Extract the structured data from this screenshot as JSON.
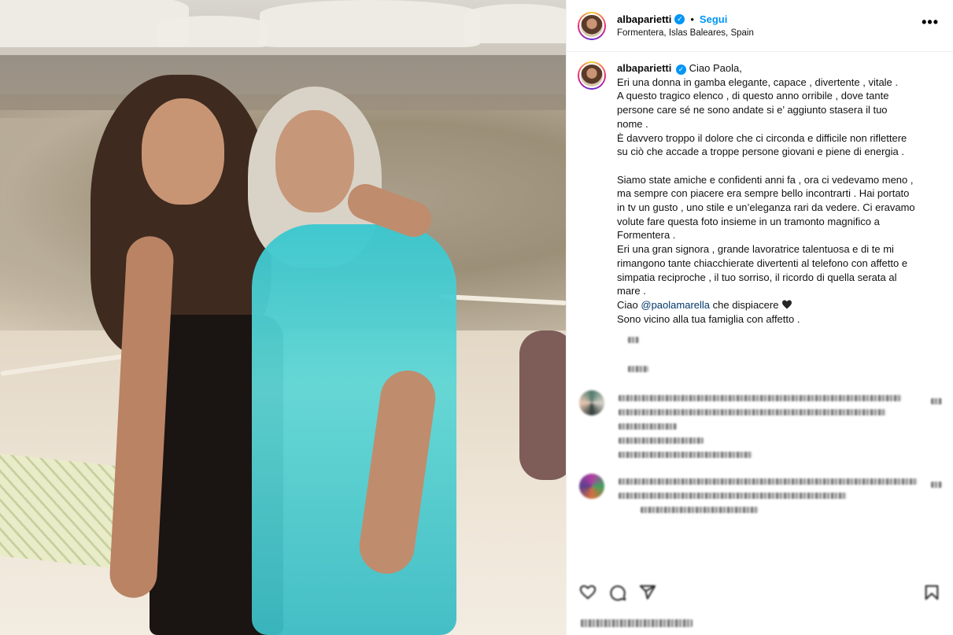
{
  "header": {
    "username": "albaparietti",
    "verified_mark": "✓",
    "separator": "•",
    "follow_label": "Segui",
    "location": "Formentera, Islas Baleares, Spain",
    "more_label": "•••"
  },
  "caption": {
    "username": "albaparietti",
    "lines": [
      "Ciao Paola,",
      "Eri una donna in gamba elegante, capace , divertente , vitale .",
      "A questo tragico elenco , di questo anno orribile , dove tante",
      "persone care sé ne sono andate si e’ aggiunto stasera il tuo",
      "nome .",
      "È davvero troppo il dolore che ci circonda e difficile non riflettere",
      "su ciò che accade a troppe persone giovani e piene di energia .",
      "",
      "Siamo state amiche e confidenti anni fa , ora ci vedevamo meno ,",
      "ma sempre con piacere era sempre bello incontrarti . Hai portato",
      "in tv un gusto , uno stile e un’eleganza rari da vedere. Ci eravamo",
      "volute fare questa foto insieme in un tramonto magnifico a",
      "Formentera .",
      "Eri una gran signora , grande lavoratrice talentuosa e di te mi",
      "rimangono tante chiacchierate divertenti al telefono con affetto e",
      "simpatia reciproche , il tuo sorriso, il ricordo di quella serata al",
      "mare ."
    ],
    "ciao_prefix": "Ciao",
    "mention": "@paolamarella",
    "ciao_suffix": "che dispiacere",
    "closing": "Sono vicino alla tua famiglia con affetto ."
  },
  "icons": {
    "verified": "verified-badge-icon",
    "heart": "black-heart-icon",
    "more": "more-options-icon",
    "like": "heart-outline-icon",
    "comment": "comment-icon",
    "share": "share-icon",
    "save": "bookmark-icon"
  },
  "colors": {
    "accent_blue": "#0095f6",
    "mention": "#00376b",
    "dress": "#39c7cf"
  }
}
